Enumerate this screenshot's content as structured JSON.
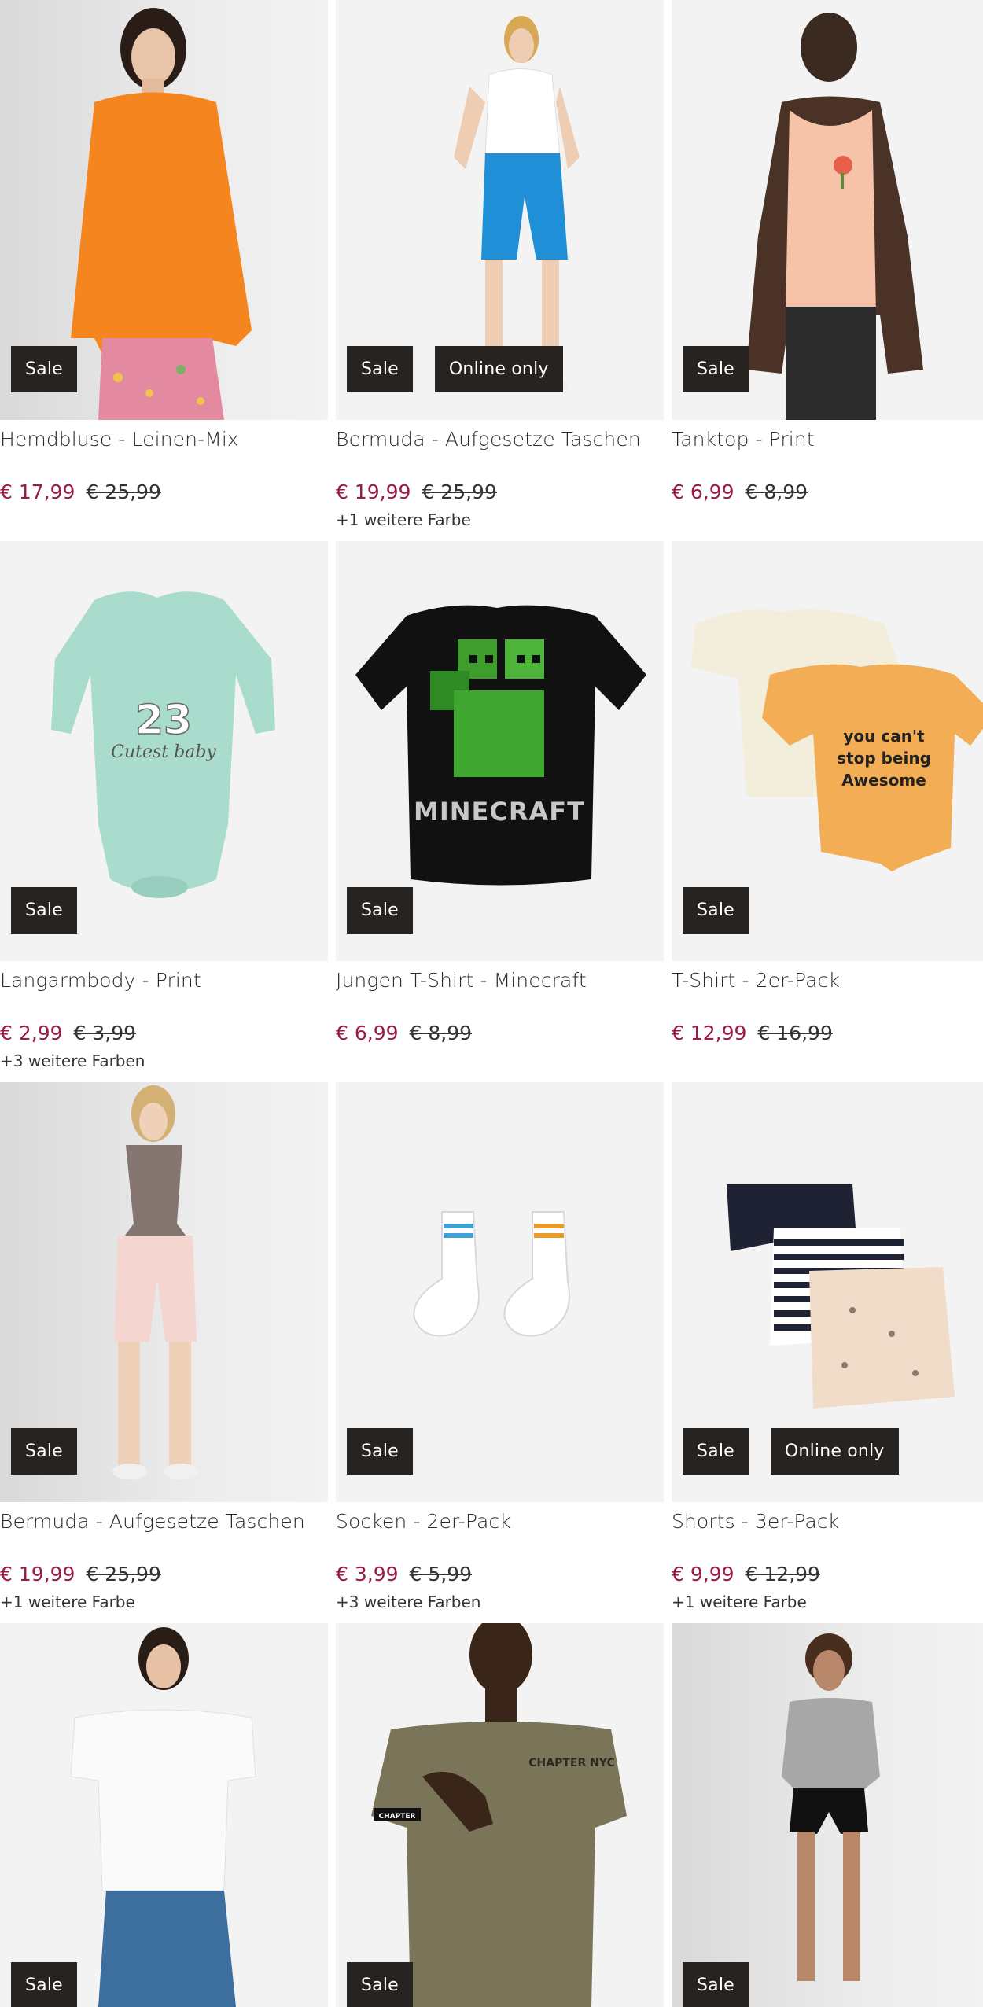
{
  "products": [
    {
      "title": "Hemdbluse - Leinen-Mix",
      "price": "€ 17,99",
      "old_price": "€ 25,99",
      "badges": [
        "Sale"
      ],
      "colors": ""
    },
    {
      "title": "Bermuda - Aufgesetze Taschen",
      "price": "€ 19,99",
      "old_price": "€ 25,99",
      "badges": [
        "Sale",
        "Online only"
      ],
      "colors": "+1 weitere Farbe"
    },
    {
      "title": "Tanktop - Print",
      "price": "€ 6,99",
      "old_price": "€ 8,99",
      "badges": [
        "Sale"
      ],
      "colors": ""
    },
    {
      "title": "Langarmbody - Print",
      "price": "€ 2,99",
      "old_price": "€ 3,99",
      "badges": [
        "Sale"
      ],
      "colors": "+3 weitere Farben",
      "graphic_text": [
        "23",
        "Cutest baby"
      ]
    },
    {
      "title": "Jungen T-Shirt - Minecraft",
      "price": "€ 6,99",
      "old_price": "€ 8,99",
      "badges": [
        "Sale"
      ],
      "colors": "",
      "graphic_text": [
        "MINECRAFT"
      ]
    },
    {
      "title": "T-Shirt - 2er-Pack",
      "price": "€ 12,99",
      "old_price": "€ 16,99",
      "badges": [
        "Sale"
      ],
      "colors": "",
      "graphic_text": [
        "you can't",
        "stop being",
        "Awesome"
      ]
    },
    {
      "title": "Bermuda - Aufgesetze Taschen",
      "price": "€ 19,99",
      "old_price": "€ 25,99",
      "badges": [
        "Sale"
      ],
      "colors": "+1 weitere Farbe"
    },
    {
      "title": "Socken - 2er-Pack",
      "price": "€ 3,99",
      "old_price": "€ 5,99",
      "badges": [
        "Sale"
      ],
      "colors": "+3 weitere Farben"
    },
    {
      "title": "Shorts - 3er-Pack",
      "price": "€ 9,99",
      "old_price": "€ 12,99",
      "badges": [
        "Sale",
        "Online only"
      ],
      "colors": "+1 weitere Farbe"
    },
    {
      "title": "",
      "price": "",
      "old_price": "",
      "badges": [
        "Sale"
      ],
      "colors": ""
    },
    {
      "title": "",
      "price": "",
      "old_price": "",
      "badges": [
        "Sale"
      ],
      "colors": "",
      "graphic_text": [
        "CHAPTER",
        "CHAPTER NYC"
      ]
    },
    {
      "title": "",
      "price": "",
      "old_price": "",
      "badges": [
        "Sale"
      ],
      "colors": ""
    }
  ],
  "colors": {
    "sale_price": "#9b1b45",
    "badge_bg": "#262321"
  }
}
